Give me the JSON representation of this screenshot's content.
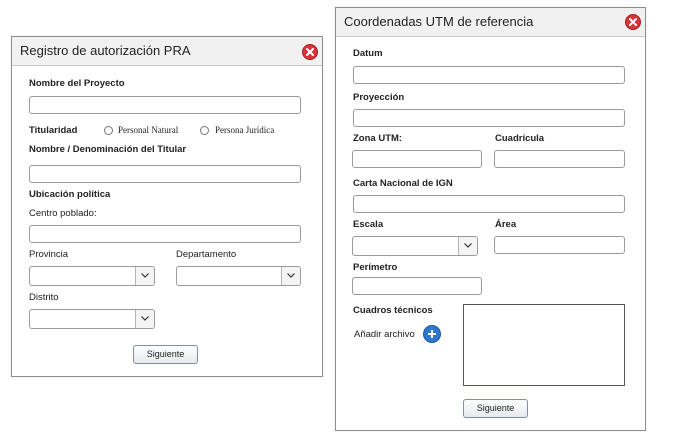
{
  "dialog1": {
    "title": "Registro de autorización PRA",
    "project_name_label": "Nombre del Proyecto",
    "project_name_value": "",
    "ownership_label": "Titularidad",
    "radio_natural": "Personal Natural",
    "radio_juridica": "Persona Jurídica",
    "holder_label": "Nombre / Denominación del Titular",
    "holder_value": "",
    "location_label": "Ubicación política",
    "town_label": "Centro poblado:",
    "town_value": "",
    "province_label": "Provincia",
    "department_label": "Departamento",
    "district_label": "Distrito",
    "next_label": "Siguiente"
  },
  "dialog2": {
    "title": "Coordenadas UTM de referencia",
    "datum_label": "Datum",
    "datum_value": "",
    "projection_label": "Proyección",
    "projection_value": "",
    "zone_label": "Zona UTM:",
    "zone_value": "",
    "grid_label": "Cuadrícula",
    "grid_value": "",
    "chart_label": "Carta Nacional de IGN",
    "chart_value": "",
    "scale_label": "Escala",
    "area_label": "Área",
    "area_value": "",
    "perimeter_label": "Perímetro",
    "perimeter_value": "",
    "tech_label": "Cuadros técnicos",
    "add_file_label": "Añadir archivo",
    "next_label": "Siguiente"
  },
  "colors": {
    "close": "#d9343a",
    "add": "#2f76cf",
    "titlebar": "#f1f1f1"
  }
}
